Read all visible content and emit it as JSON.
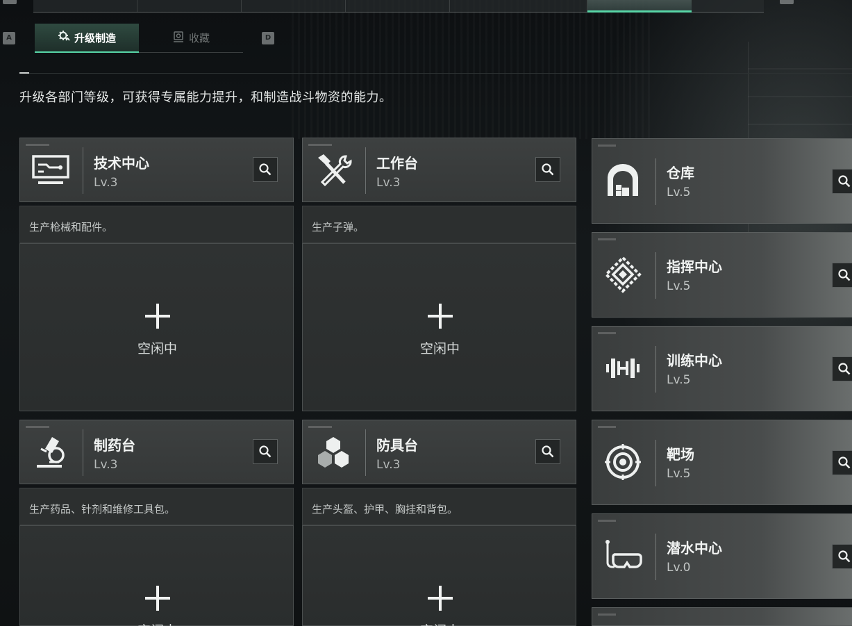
{
  "key_hints": {
    "left": "A",
    "right": "D"
  },
  "tabs": [
    {
      "label": "升级制造",
      "active": true,
      "icon": "upgrade-gear-icon"
    },
    {
      "label": "收藏",
      "active": false,
      "icon": "collection-icon"
    }
  ],
  "description": "升级各部门等级，可获得专属能力提升，和制造战斗物资的能力。",
  "workbenches": [
    {
      "name": "技术中心",
      "level": "Lv.3",
      "icon": "computer-icon",
      "desc": "生产枪械和配件。",
      "status": "空闲中"
    },
    {
      "name": "工作台",
      "level": "Lv.3",
      "icon": "hammer-wrench-icon",
      "desc": "生产子弹。",
      "status": "空闲中"
    },
    {
      "name": "制药台",
      "level": "Lv.3",
      "icon": "microscope-icon",
      "desc": "生产药品、针剂和维修工具包。",
      "status": "空闲中"
    },
    {
      "name": "防具台",
      "level": "Lv.3",
      "icon": "boxes-icon",
      "desc": "生产头盔、护甲、胸挂和背包。",
      "status": "空闲中"
    }
  ],
  "facilities": [
    {
      "name": "仓库",
      "level": "Lv.5",
      "icon": "warehouse-icon"
    },
    {
      "name": "指挥中心",
      "level": "Lv.5",
      "icon": "command-center-icon"
    },
    {
      "name": "训练中心",
      "level": "Lv.5",
      "icon": "dumbbell-icon"
    },
    {
      "name": "靶场",
      "level": "Lv.5",
      "icon": "target-icon"
    },
    {
      "name": "潜水中心",
      "level": "Lv.0",
      "icon": "diving-mask-icon"
    }
  ],
  "colors": {
    "accent": "#58d6a7",
    "card": "#3a3d3d",
    "background": "#101314"
  }
}
